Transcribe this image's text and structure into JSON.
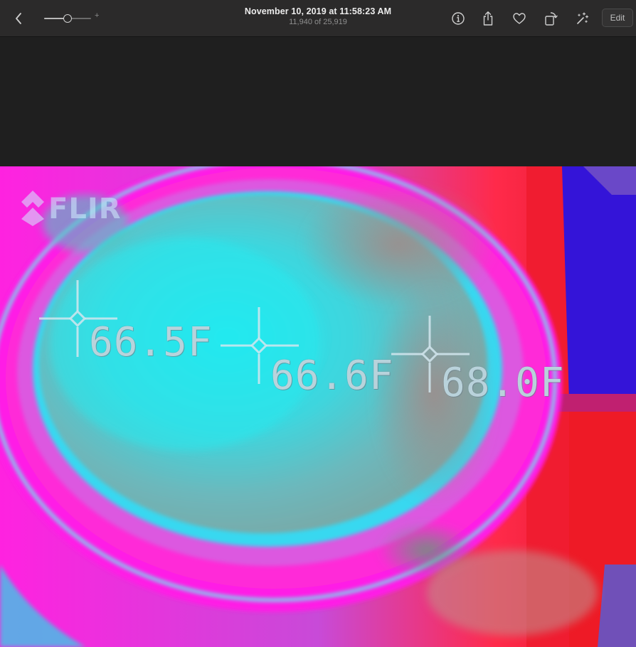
{
  "toolbar": {
    "title": "November 10, 2019 at 11:58:23 AM",
    "subtitle": "11,940 of 25,919",
    "zoom_plus": "+",
    "edit_label": "Edit",
    "zoom_level": 0.5,
    "icons": [
      "chevron-left-icon",
      "info-icon",
      "share-icon",
      "heart-icon",
      "rotate-icon",
      "magic-wand-icon"
    ]
  },
  "photo": {
    "logo_text": "FLIR",
    "readings": [
      {
        "label": "66.5F"
      },
      {
        "label": "66.6F"
      },
      {
        "label": "68.0F"
      }
    ]
  }
}
